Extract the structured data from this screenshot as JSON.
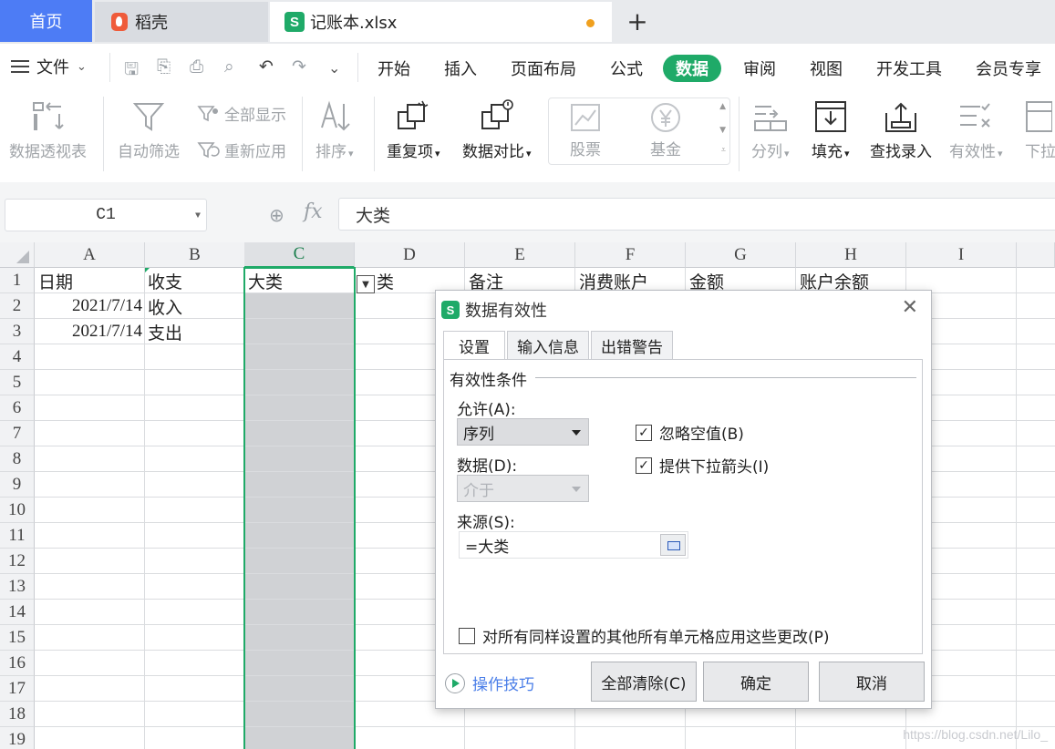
{
  "tabs": {
    "home": "首页",
    "daoke": "稻壳",
    "file": "记账本.xlsx",
    "s_logo": "S",
    "new_tab": "+"
  },
  "menu": {
    "file": "文件",
    "tabs": [
      "开始",
      "插入",
      "页面布局",
      "公式",
      "数据",
      "审阅",
      "视图",
      "开发工具",
      "会员专享"
    ],
    "active_tab": "数据"
  },
  "ribbon": {
    "pivot": "数据透视表",
    "autofilter": "自动筛选",
    "show_all": "全部显示",
    "reapply": "重新应用",
    "sort": "排序",
    "duplicates": "重复项",
    "compare": "数据对比",
    "stock": "股票",
    "fund": "基金",
    "split": "分列",
    "fill": "填充",
    "lookup": "查找录入",
    "validity": "有效性",
    "dropdown": "下拉"
  },
  "formula_bar": {
    "name_box": "C1",
    "fx": "fx",
    "content": "大类"
  },
  "sheet": {
    "columns": [
      "A",
      "B",
      "C",
      "D",
      "E",
      "F",
      "G",
      "H",
      "I"
    ],
    "rows": [
      "1",
      "2",
      "3",
      "4",
      "5",
      "6",
      "7",
      "8",
      "9",
      "10",
      "11",
      "12",
      "13",
      "14",
      "15",
      "16",
      "17",
      "18",
      "19"
    ],
    "selected_column": "C",
    "header_row": [
      "日期",
      "收支",
      "大类",
      "小类",
      "备注",
      "消费账户",
      "金额",
      "账户余额"
    ],
    "row2": {
      "date": "2021/7/14",
      "type": "收入"
    },
    "row3": {
      "date": "2021/7/14",
      "type": "支出"
    },
    "d1_partial": "类"
  },
  "dialog": {
    "s_logo": "S",
    "title": "数据有效性",
    "close": "✕",
    "tabs": [
      "设置",
      "输入信息",
      "出错警告"
    ],
    "active_tab": "设置",
    "group_title": "有效性条件",
    "allow_label": "允许(A):",
    "allow_value": "序列",
    "data_label": "数据(D):",
    "data_value": "介于",
    "ignore_blank": "忽略空值(B)",
    "ignore_blank_checked": true,
    "show_dropdown": "提供下拉箭头(I)",
    "show_dropdown_checked": true,
    "source_label": "来源(S):",
    "source_value": "=大类",
    "apply_all": "对所有同样设置的其他所有单元格应用这些更改(P)",
    "apply_all_checked": false,
    "tips": "操作技巧",
    "clear_all": "全部清除(C)",
    "ok": "确定",
    "cancel": "取消",
    "checkmark": "✓"
  },
  "watermark": "https://blog.csdn.net/Lilo_",
  "colors": {
    "accent_green": "#1faa68",
    "home_tab_blue": "#4d7cf5",
    "link_blue": "#4a7ee8",
    "unsaved_dot": "#f0a01e"
  }
}
